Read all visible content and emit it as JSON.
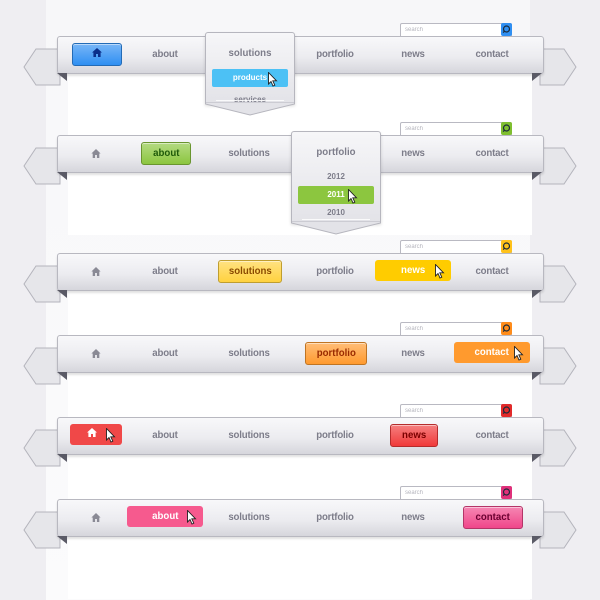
{
  "search_placeholder": "search",
  "nav_labels": [
    "about",
    "solutions",
    "portfolio",
    "news",
    "contact"
  ],
  "navbars": [
    {
      "theme": "blue",
      "accent": "#2f8ff2",
      "accent_dark": "#1f5fd0",
      "text_on_accent": "#0b2f8a",
      "active_item": "home",
      "hover_item": null,
      "search_button_color": "#2f8ff2",
      "items": [
        {
          "key": "home",
          "label": "",
          "icon": "home-icon",
          "state": "active"
        },
        {
          "key": "about",
          "label": "about",
          "state": "normal"
        },
        {
          "key": "solutions",
          "label": "solutions",
          "state": "dropdown-open"
        },
        {
          "key": "portfolio",
          "label": "portfolio",
          "state": "normal"
        },
        {
          "key": "news",
          "label": "news",
          "state": "normal"
        },
        {
          "key": "contact",
          "label": "contact",
          "state": "normal"
        }
      ],
      "dropdown": {
        "parent": "solutions",
        "items": [
          {
            "label": "products",
            "state": "hover"
          },
          {
            "label": "services",
            "state": "normal"
          }
        ],
        "hover_color": "#4cc1f5"
      }
    },
    {
      "theme": "green",
      "accent": "#8cc63f",
      "text_on_accent": "#1f5a0a",
      "active_item": "about",
      "search_button_color": "#7fbf2f",
      "items": [
        {
          "key": "home",
          "label": "",
          "icon": "home-icon",
          "state": "normal"
        },
        {
          "key": "about",
          "label": "about",
          "state": "active"
        },
        {
          "key": "solutions",
          "label": "solutions",
          "state": "normal"
        },
        {
          "key": "portfolio",
          "label": "portfolio",
          "state": "dropdown-open"
        },
        {
          "key": "news",
          "label": "news",
          "state": "normal"
        },
        {
          "key": "contact",
          "label": "contact",
          "state": "normal"
        }
      ],
      "dropdown": {
        "parent": "portfolio",
        "items": [
          {
            "label": "2012",
            "state": "normal"
          },
          {
            "label": "2011",
            "state": "hover"
          },
          {
            "label": "2010",
            "state": "normal"
          }
        ],
        "hover_color": "#8cc63f"
      }
    },
    {
      "theme": "yellow",
      "accent": "#ffd23f",
      "text_on_accent": "#8a4a00",
      "active_item": "solutions",
      "hover_item": "news",
      "hover_color": "#ffcc00",
      "search_button_color": "#ffc21a",
      "items": [
        {
          "key": "home",
          "label": "",
          "icon": "home-icon",
          "state": "normal"
        },
        {
          "key": "about",
          "label": "about",
          "state": "normal"
        },
        {
          "key": "solutions",
          "label": "solutions",
          "state": "active"
        },
        {
          "key": "portfolio",
          "label": "portfolio",
          "state": "normal"
        },
        {
          "key": "news",
          "label": "news",
          "state": "hover"
        },
        {
          "key": "contact",
          "label": "contact",
          "state": "normal"
        }
      ]
    },
    {
      "theme": "orange",
      "accent": "#ff9a2e",
      "text_on_accent": "#9a2a00",
      "active_item": "portfolio",
      "hover_item": "contact",
      "hover_color": "#ff9a2e",
      "search_button_color": "#ff8c1a",
      "items": [
        {
          "key": "home",
          "label": "",
          "icon": "home-icon",
          "state": "normal"
        },
        {
          "key": "about",
          "label": "about",
          "state": "normal"
        },
        {
          "key": "solutions",
          "label": "solutions",
          "state": "normal"
        },
        {
          "key": "portfolio",
          "label": "portfolio",
          "state": "active"
        },
        {
          "key": "news",
          "label": "news",
          "state": "normal"
        },
        {
          "key": "contact",
          "label": "contact",
          "state": "hover"
        }
      ]
    },
    {
      "theme": "red",
      "accent": "#f03a3a",
      "text_on_accent": "#7a0000",
      "active_item": "news",
      "hover_item": "home",
      "hover_color": "#f04848",
      "search_button_color": "#e22a2a",
      "items": [
        {
          "key": "home",
          "label": "",
          "icon": "home-icon",
          "state": "hover"
        },
        {
          "key": "about",
          "label": "about",
          "state": "normal"
        },
        {
          "key": "solutions",
          "label": "solutions",
          "state": "normal"
        },
        {
          "key": "portfolio",
          "label": "portfolio",
          "state": "normal"
        },
        {
          "key": "news",
          "label": "news",
          "state": "active"
        },
        {
          "key": "contact",
          "label": "contact",
          "state": "normal"
        }
      ]
    },
    {
      "theme": "pink",
      "accent": "#f0468a",
      "text_on_accent": "#6a0030",
      "active_item": "contact",
      "hover_item": "about",
      "hover_color": "#f65a8e",
      "search_button_color": "#e0307a",
      "items": [
        {
          "key": "home",
          "label": "",
          "icon": "home-icon",
          "state": "normal"
        },
        {
          "key": "about",
          "label": "about",
          "state": "hover"
        },
        {
          "key": "solutions",
          "label": "solutions",
          "state": "normal"
        },
        {
          "key": "portfolio",
          "label": "portfolio",
          "state": "normal"
        },
        {
          "key": "news",
          "label": "news",
          "state": "normal"
        },
        {
          "key": "contact",
          "label": "contact",
          "state": "active"
        }
      ]
    }
  ]
}
